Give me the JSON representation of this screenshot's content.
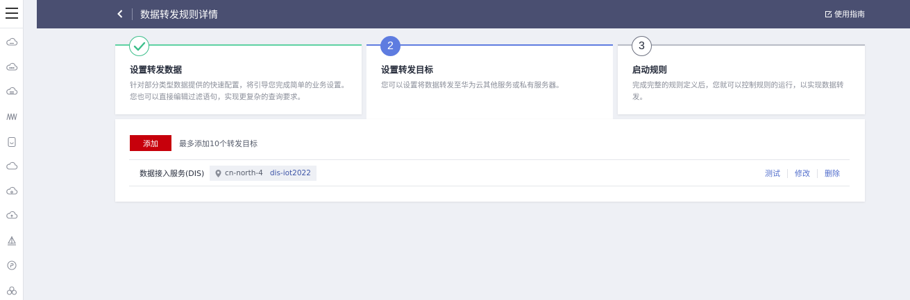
{
  "rail": {
    "icons": [
      "menu-icon",
      "cloud-icon",
      "cloud-dots-icon",
      "cloud-stack-icon",
      "waves-icon",
      "device-icon",
      "cloud-refresh-icon",
      "cloud-gear-icon",
      "cloud-upload-icon",
      "ship-icon",
      "coin-icon",
      "cloud-cluster-icon"
    ]
  },
  "header": {
    "title": "数据转发规则详情",
    "guide_label": "使用指南"
  },
  "steps": [
    {
      "number": "",
      "state": "done",
      "title": "设置转发数据",
      "desc": "针对部分类型数据提供的快速配置，将引导您完成简单的业务设置。您也可以直接编辑过滤语句，实现更复杂的查询要求。"
    },
    {
      "number": "2",
      "state": "active",
      "title": "设置转发目标",
      "desc": "您可以设置将数据转发至华为云其他服务或私有服务器。"
    },
    {
      "number": "3",
      "state": "pending",
      "title": "启动规则",
      "desc": "完成完整的规则定义后，您就可以控制规则的运行，以实现数据转发。"
    }
  ],
  "panel": {
    "add_label": "添加",
    "add_hint": "最多添加10个转发目标",
    "target": {
      "service": "数据接入服务(DIS)",
      "region": "cn-north-4",
      "stream": "dis-iot2022",
      "ops": {
        "test": "测试",
        "edit": "修改",
        "delete": "删除"
      }
    }
  },
  "colors": {
    "header_bg": "#4a4f71",
    "accent_blue": "#5e7ce0",
    "done_green": "#3dbf8b",
    "add_red": "#c7000b",
    "link_blue": "#526ecc"
  }
}
